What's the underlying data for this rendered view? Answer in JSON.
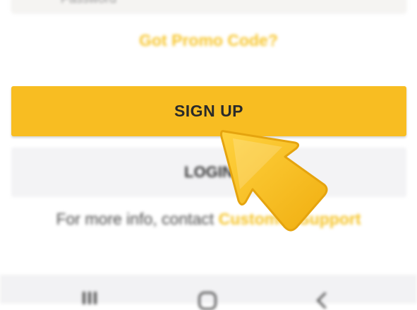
{
  "form": {
    "field_hint": "Password",
    "promo_link": "Got Promo Code?",
    "signup_label": "SIGN UP",
    "login_label": "LOGIN",
    "info_text": "For more info, contact ",
    "support_link": "Customer Support"
  },
  "icons": {
    "pointer": "pointer-arrow-icon",
    "nav_recent": "recent-apps-icon",
    "nav_home": "home-icon",
    "nav_back": "back-icon"
  },
  "colors": {
    "accent": "#f8bd22",
    "link": "#f5c325",
    "pointer": "#f5b91c"
  }
}
